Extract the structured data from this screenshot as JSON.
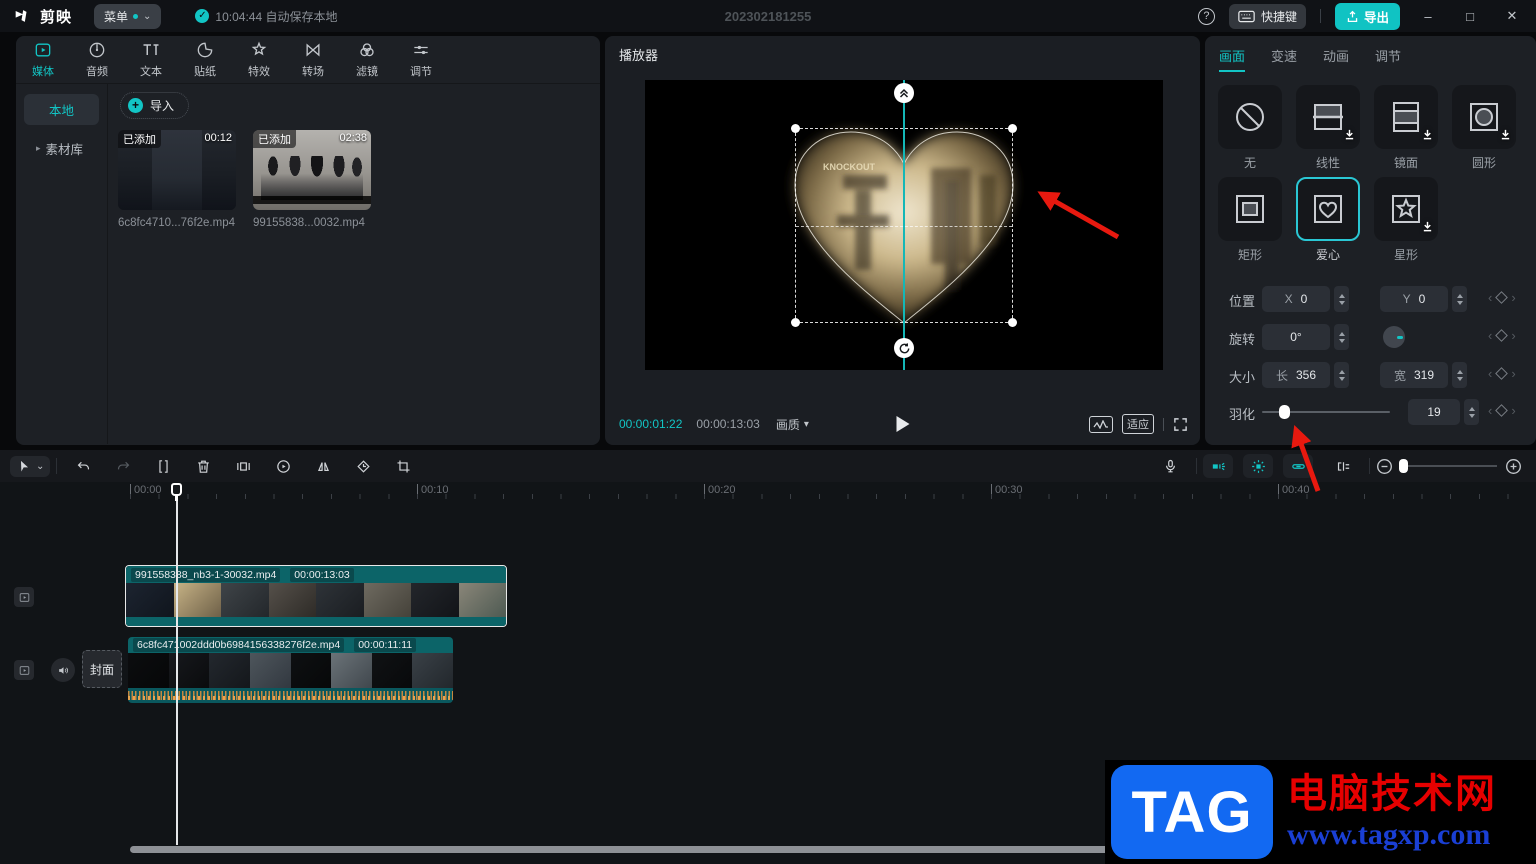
{
  "colors": {
    "accent": "#12c5c5",
    "export_button": "#10c3c3",
    "annotation_arrow": "#e8190f",
    "clip_teal": "#0c6468"
  },
  "titlebar": {
    "logo": "剪映",
    "menu_label": "菜单",
    "autosave": "10:04:44 自动保存本地",
    "project_title": "202302181255",
    "shortcut_label": "快捷键",
    "export_label": "导出",
    "minimize": "–",
    "maximize": "□",
    "close": "✕",
    "help": "?"
  },
  "media_panel": {
    "tabs": [
      {
        "label": "媒体",
        "icon": "media-icon",
        "active": true
      },
      {
        "label": "音频",
        "icon": "audio-icon"
      },
      {
        "label": "文本",
        "icon": "text-icon"
      },
      {
        "label": "贴纸",
        "icon": "sticker-icon"
      },
      {
        "label": "特效",
        "icon": "effects-icon"
      },
      {
        "label": "转场",
        "icon": "transition-icon"
      },
      {
        "label": "滤镜",
        "icon": "filter-icon"
      },
      {
        "label": "调节",
        "icon": "adjust-icon"
      }
    ],
    "sidebar": [
      {
        "label": "本地",
        "active": true
      },
      {
        "label": "素材库"
      }
    ],
    "import_label": "导入",
    "items": [
      {
        "badge": "已添加",
        "duration": "00:12",
        "name": "6c8fc4710...76f2e.mp4"
      },
      {
        "badge": "已添加",
        "duration": "02:38",
        "name": "99155838...0032.mp4"
      }
    ]
  },
  "player": {
    "title": "播放器",
    "current_time": "00:00:01:22",
    "total_time": "00:00:13:03",
    "quality_label": "画质",
    "fit_label": "适应",
    "overlay_text": "KNOCKOUT"
  },
  "inspector": {
    "tabs": [
      {
        "label": "画面",
        "active": true
      },
      {
        "label": "变速"
      },
      {
        "label": "动画"
      },
      {
        "label": "调节"
      }
    ],
    "masks": [
      {
        "label": "无",
        "icon": "mask-none-icon"
      },
      {
        "label": "线性",
        "icon": "mask-linear-icon",
        "download": true
      },
      {
        "label": "镜面",
        "icon": "mask-mirror-icon",
        "download": true
      },
      {
        "label": "圆形",
        "icon": "mask-circle-icon",
        "download": true
      },
      {
        "label": "矩形",
        "icon": "mask-rect-icon"
      },
      {
        "label": "爱心",
        "icon": "mask-heart-icon",
        "selected": true
      },
      {
        "label": "星形",
        "icon": "mask-star-icon",
        "download": true
      }
    ],
    "position": {
      "label": "位置",
      "x_label": "X",
      "x": "0",
      "y_label": "Y",
      "y": "0"
    },
    "rotation": {
      "label": "旋转",
      "value": "0°"
    },
    "size": {
      "label": "大小",
      "w_label": "长",
      "w": "356",
      "h_label": "宽",
      "h": "319"
    },
    "feather": {
      "label": "羽化",
      "value": "19"
    }
  },
  "timeline": {
    "ruler": [
      "00:00",
      "00:10",
      "00:20",
      "00:30",
      "00:40"
    ],
    "cover_label": "封面",
    "clips": [
      {
        "name": "991558388_nb3-1-30032.mp4",
        "duration": "00:00:13:03"
      },
      {
        "name": "6c8fc471002ddd0b6984156338276f2e.mp4",
        "duration": "00:00:11:11"
      }
    ]
  },
  "watermark": {
    "logo": "TAG",
    "line1": "电脑技术网",
    "line2": "www.tagxp.com"
  }
}
